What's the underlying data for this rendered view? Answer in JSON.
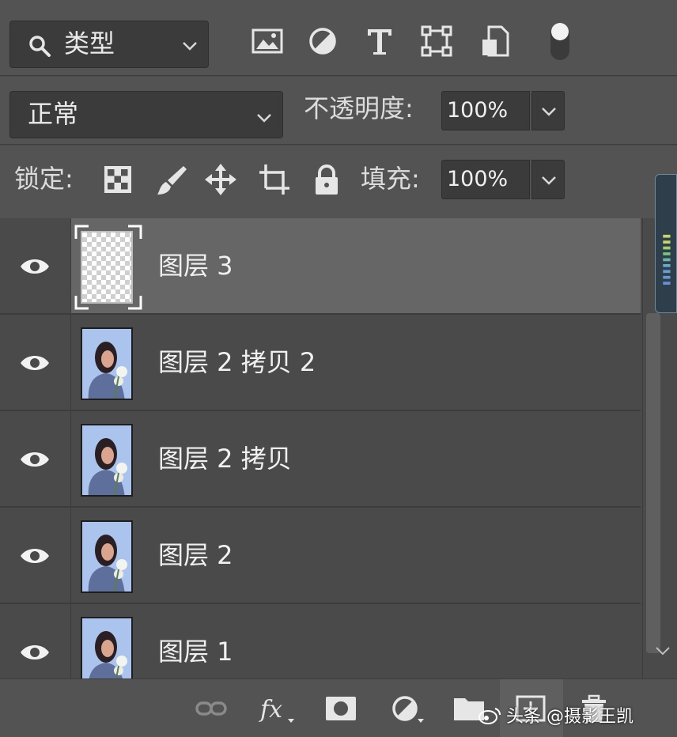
{
  "filter": {
    "label": "类型"
  },
  "blend": {
    "mode": "正常",
    "opacity_label": "不透明度:",
    "opacity_value": "100%"
  },
  "lock": {
    "label": "锁定:",
    "fill_label": "填充:",
    "fill_value": "100%"
  },
  "layers": [
    {
      "name": "图层 3",
      "thumb": "transparent",
      "selected": true,
      "visible": true
    },
    {
      "name": "图层 2 拷贝 2",
      "thumb": "photo",
      "selected": false,
      "visible": true
    },
    {
      "name": "图层 2 拷贝",
      "thumb": "photo",
      "selected": false,
      "visible": true
    },
    {
      "name": "图层 2",
      "thumb": "photo",
      "selected": false,
      "visible": true
    },
    {
      "name": "图层 1",
      "thumb": "photo",
      "selected": false,
      "visible": true
    }
  ],
  "watermark": {
    "text": "头条 @摄影王凯"
  },
  "colors": {
    "panel": "#535353",
    "list": "#4a4a4a",
    "selected": "#666666",
    "field": "#3b3b3b"
  }
}
